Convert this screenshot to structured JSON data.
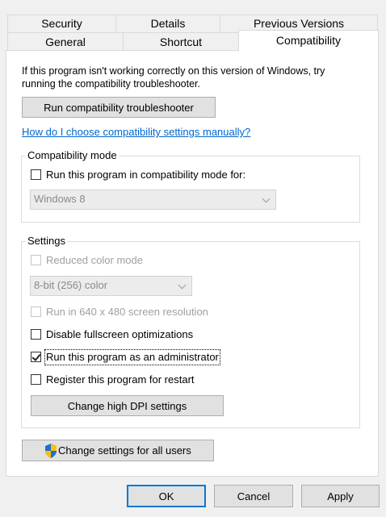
{
  "tabs": {
    "row1": [
      "Security",
      "Details",
      "Previous Versions"
    ],
    "row2": [
      "General",
      "Shortcut",
      "Compatibility"
    ],
    "active": "Compatibility"
  },
  "intro": {
    "line1": "If this program isn't working correctly on this version of Windows, try",
    "line2": "running the compatibility troubleshooter."
  },
  "troubleshooter_button": "Run compatibility troubleshooter",
  "help_link": "How do I choose compatibility settings manually?",
  "compat_mode": {
    "label": "Compatibility mode",
    "checkbox_label": "Run this program in compatibility mode for:",
    "checked": false,
    "os_value": "Windows 8"
  },
  "settings": {
    "label": "Settings",
    "reduced_color": {
      "label": "Reduced color mode",
      "checked": false,
      "enabled": false
    },
    "color_value": "8-bit (256) color",
    "res_640": {
      "label": "Run in 640 x 480 screen resolution",
      "checked": false,
      "enabled": false
    },
    "fullscreen": {
      "label": "Disable fullscreen optimizations",
      "checked": false,
      "enabled": true
    },
    "admin": {
      "label": "Run this program as an administrator",
      "checked": true,
      "enabled": true
    },
    "restart": {
      "label": "Register this program for restart",
      "checked": false,
      "enabled": true
    },
    "dpi_button": "Change high DPI settings"
  },
  "all_users_button": "Change settings for all users",
  "footer": {
    "ok": "OK",
    "cancel": "Cancel",
    "apply": "Apply"
  },
  "colors": {
    "accent": "#0078d7",
    "link": "#0066cc",
    "shield_blue": "#1f6fd1",
    "shield_yellow": "#f4c20d"
  },
  "icons": {
    "shield": "uac-shield-icon"
  }
}
